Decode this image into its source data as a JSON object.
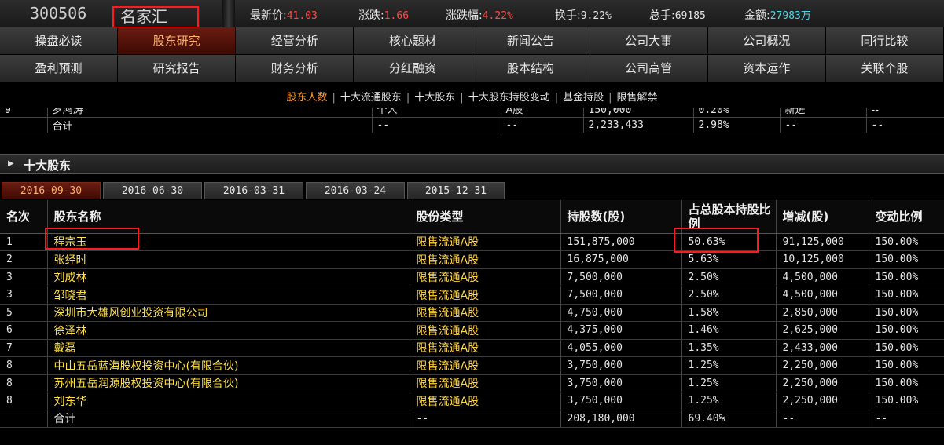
{
  "stock": {
    "code": "300506",
    "name": "名家汇",
    "quotes": [
      {
        "label": "最新价:",
        "value": "41.03",
        "color": "red"
      },
      {
        "label": "涨跌:",
        "value": "1.66",
        "color": "red"
      },
      {
        "label": "涨跌幅:",
        "value": "4.22%",
        "color": "red"
      },
      {
        "label": "换手:",
        "value": "9.22%",
        "color": "white"
      },
      {
        "label": "总手:",
        "value": "69185",
        "color": "white"
      },
      {
        "label": "金额:",
        "value": "27983万",
        "color": "cyan"
      }
    ]
  },
  "nav": {
    "row1": [
      "操盘必读",
      "股东研究",
      "经营分析",
      "核心题材",
      "新闻公告",
      "公司大事",
      "公司概况",
      "同行比较"
    ],
    "row2": [
      "盈利预测",
      "研究报告",
      "财务分析",
      "分红融资",
      "股本结构",
      "公司高管",
      "资本运作",
      "关联个股"
    ],
    "active": "股东研究"
  },
  "subnav": {
    "items": [
      "股东人数",
      "十大流通股东",
      "十大股东",
      "十大股东持股变动",
      "基金持股",
      "限售解禁"
    ],
    "active": "股东人数",
    "separator": "|"
  },
  "prev_table": {
    "partial_row": [
      "9",
      "罗鸿涛",
      "个人",
      "A股",
      "150,000",
      "0.20%",
      "新进",
      "--"
    ],
    "total_row": [
      "合计",
      "--",
      "--",
      "2,233,433",
      "2.98%",
      "--",
      "--"
    ]
  },
  "section": {
    "title": "十大股东"
  },
  "date_tabs": {
    "items": [
      "2016-09-30",
      "2016-06-30",
      "2016-03-31",
      "2016-03-24",
      "2015-12-31"
    ],
    "active": "2016-09-30"
  },
  "main_table": {
    "headers": [
      "名次",
      "股东名称",
      "股份类型",
      "持股数(股)",
      "占总股本持股比例",
      "增减(股)",
      "变动比例"
    ],
    "rows": [
      [
        "1",
        "程宗玉",
        "限售流通A股",
        "151,875,000",
        "50.63%",
        "91,125,000",
        "150.00%"
      ],
      [
        "2",
        "张经时",
        "限售流通A股",
        "16,875,000",
        "5.63%",
        "10,125,000",
        "150.00%"
      ],
      [
        "3",
        "刘成林",
        "限售流通A股",
        "7,500,000",
        "2.50%",
        "4,500,000",
        "150.00%"
      ],
      [
        "3",
        "邹晓君",
        "限售流通A股",
        "7,500,000",
        "2.50%",
        "4,500,000",
        "150.00%"
      ],
      [
        "5",
        "深圳市大雄风创业投资有限公司",
        "限售流通A股",
        "4,750,000",
        "1.58%",
        "2,850,000",
        "150.00%"
      ],
      [
        "6",
        "徐泽林",
        "限售流通A股",
        "4,375,000",
        "1.46%",
        "2,625,000",
        "150.00%"
      ],
      [
        "7",
        "戴磊",
        "限售流通A股",
        "4,055,000",
        "1.35%",
        "2,433,000",
        "150.00%"
      ],
      [
        "8",
        "中山五岳蓝海股权投资中心(有限合伙)",
        "限售流通A股",
        "3,750,000",
        "1.25%",
        "2,250,000",
        "150.00%"
      ],
      [
        "8",
        "苏州五岳润源股权投资中心(有限合伙)",
        "限售流通A股",
        "3,750,000",
        "1.25%",
        "2,250,000",
        "150.00%"
      ],
      [
        "8",
        "刘东华",
        "限售流通A股",
        "3,750,000",
        "1.25%",
        "2,250,000",
        "150.00%"
      ]
    ],
    "total": [
      "",
      "合计",
      "--",
      "208,180,000",
      "69.40%",
      "--",
      "--"
    ]
  },
  "colors": {
    "accent_red": "#ff1b1b",
    "price_red": "#ff4a4a",
    "amount_cyan": "#4fd7e6",
    "active_tab_text": "#ffb066",
    "name_yellow": "#ffe04a"
  }
}
